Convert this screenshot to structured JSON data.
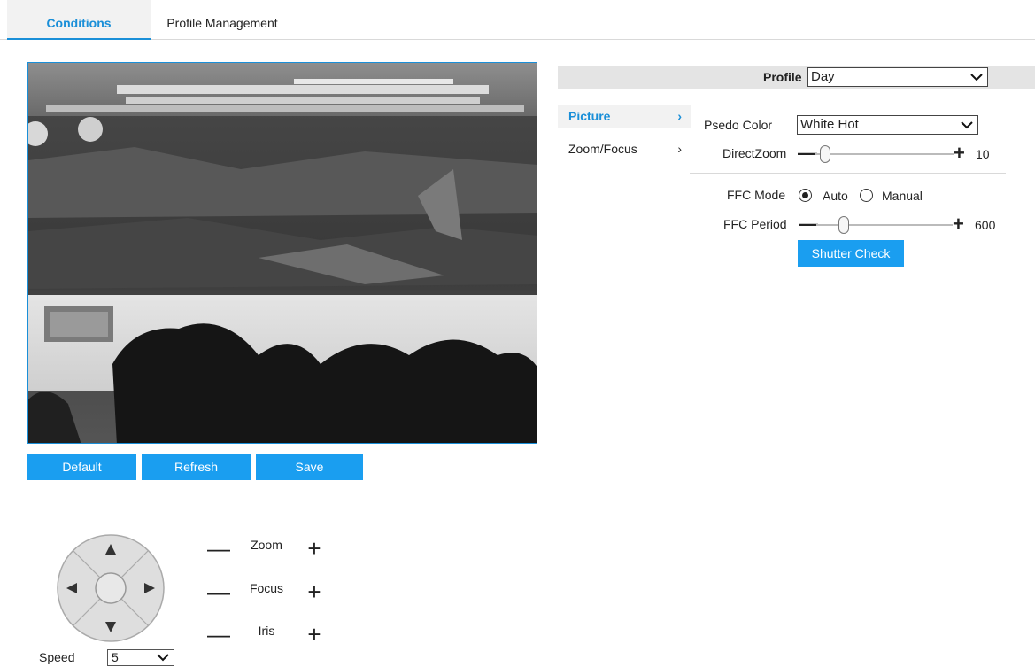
{
  "tabs": {
    "conditions": "Conditions",
    "profile_management": "Profile Management"
  },
  "actions": {
    "default": "Default",
    "refresh": "Refresh",
    "save": "Save"
  },
  "ptz": {
    "zoom": "Zoom",
    "focus": "Focus",
    "iris": "Iris",
    "minus": "—",
    "plus": "+",
    "speed_label": "Speed",
    "speed_value": "5"
  },
  "profile": {
    "label": "Profile",
    "value": "Day"
  },
  "menu": {
    "picture": "Picture",
    "zoom_focus": "Zoom/Focus",
    "arrow": "›"
  },
  "picture": {
    "psedo_color_label": "Psedo Color",
    "psedo_color_value": "White Hot",
    "direct_zoom_label": "DirectZoom",
    "direct_zoom_value": "10",
    "ffc_mode_label": "FFC Mode",
    "ffc_mode_auto": "Auto",
    "ffc_mode_manual": "Manual",
    "ffc_mode_selected": "Auto",
    "ffc_period_label": "FFC Period",
    "ffc_period_value": "600",
    "shutter_check": "Shutter Check",
    "minus": "—",
    "plus": "+"
  },
  "colors": {
    "accent": "#1a8fd8",
    "button": "#1a9ef0",
    "panel_bar": "#e4e4e4"
  }
}
